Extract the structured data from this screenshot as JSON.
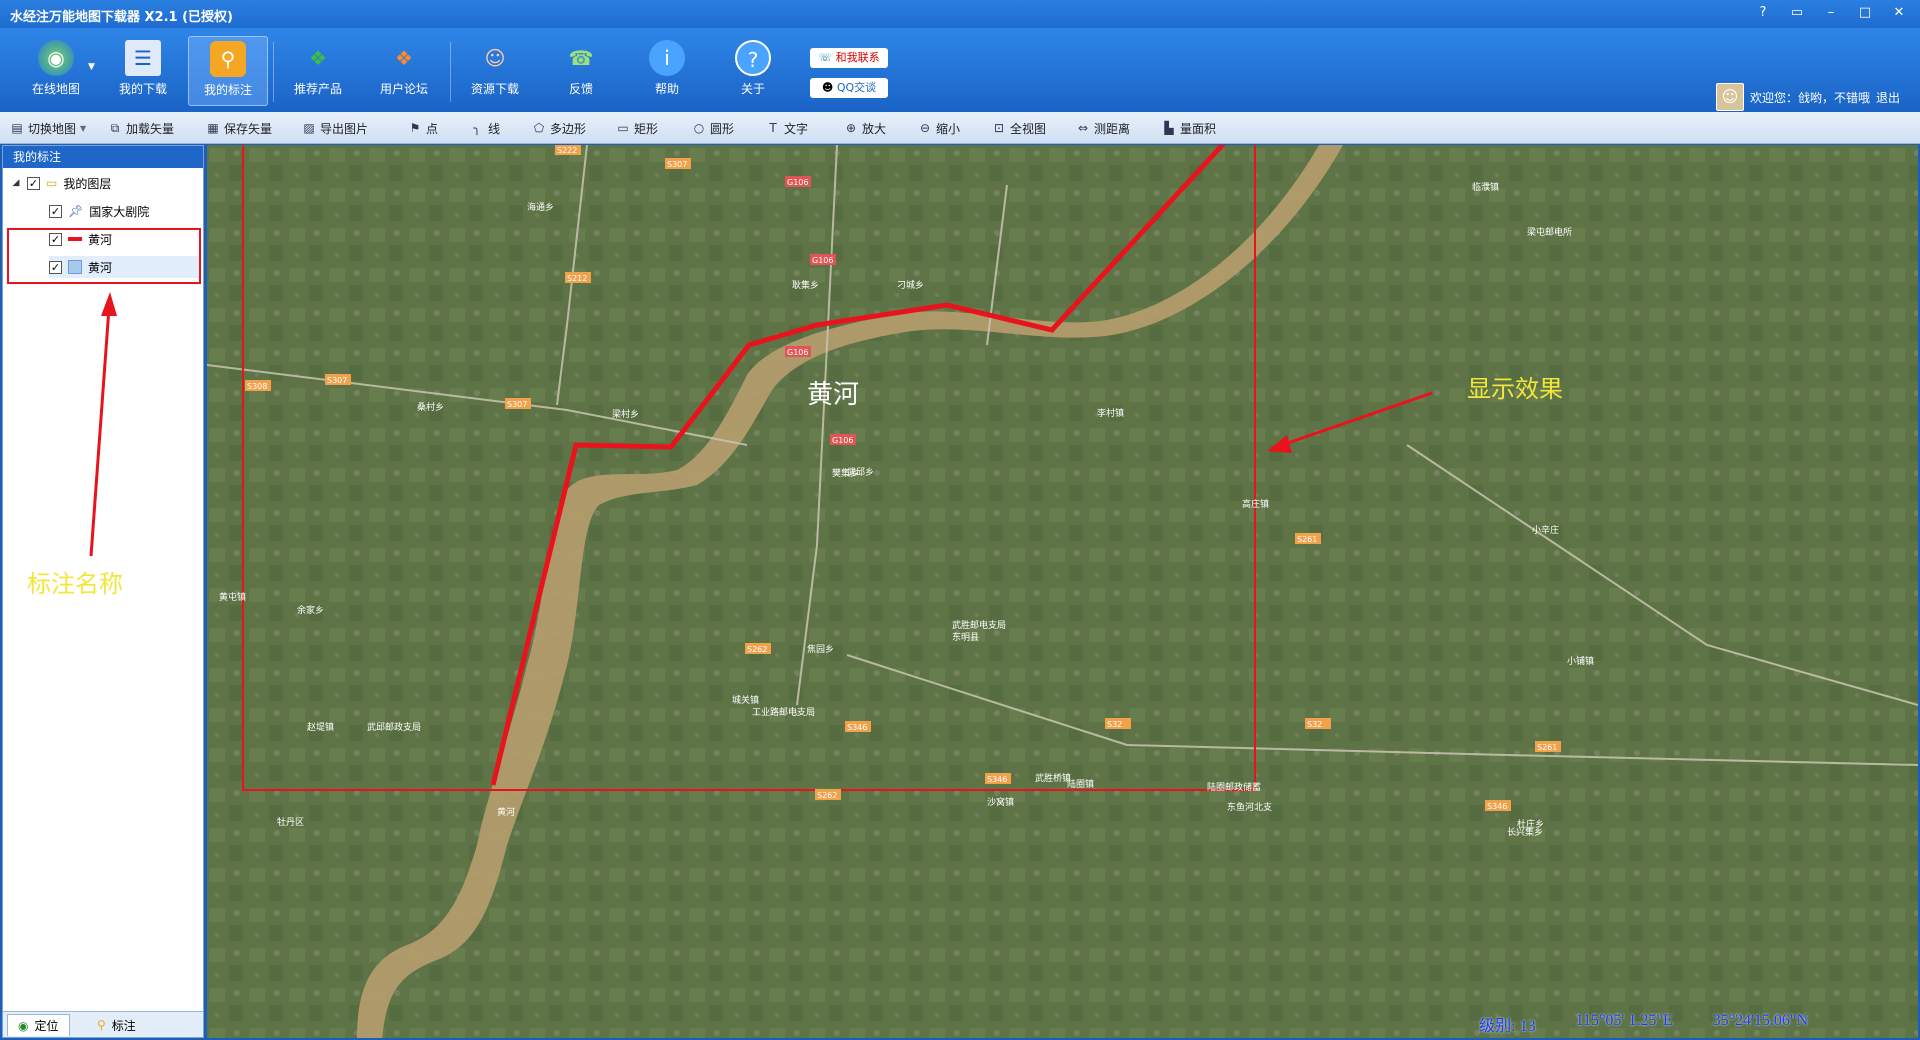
{
  "window": {
    "title": "水经注万能地图下载器 X2.1 (已授权)",
    "buttons": [
      "?",
      "▭",
      "–",
      "□",
      "✕"
    ]
  },
  "main_toolbar": {
    "buttons": [
      {
        "label": "在线地图",
        "icon": "globe-icon"
      },
      {
        "label": "我的下载",
        "icon": "download-list-icon"
      },
      {
        "label": "我的标注",
        "icon": "map-pin-icon"
      },
      {
        "label": "推荐产品",
        "icon": "cubes-icon"
      },
      {
        "label": "用户论坛",
        "icon": "forum-icon"
      },
      {
        "label": "资源下载",
        "icon": "people-icon"
      },
      {
        "label": "反馈",
        "icon": "feedback-icon"
      },
      {
        "label": "帮助",
        "icon": "info-icon"
      },
      {
        "label": "关于",
        "icon": "question-icon"
      }
    ],
    "contact_label": "和我联系",
    "qq_label": "QQ交谈",
    "user_text": "欢迎您：戗哟，不错哦",
    "logout_label": "退出"
  },
  "sub_toolbar": {
    "items": [
      {
        "label": "切换地图",
        "icon": "layers-icon"
      },
      {
        "label": "加载矢量",
        "icon": "load-vector-icon"
      },
      {
        "label": "保存矢量",
        "icon": "save-icon"
      },
      {
        "label": "导出图片",
        "icon": "export-image-icon"
      },
      {
        "label": "点",
        "icon": "point-icon"
      },
      {
        "label": "线",
        "icon": "line-icon"
      },
      {
        "label": "多边形",
        "icon": "polygon-icon"
      },
      {
        "label": "矩形",
        "icon": "rectangle-icon"
      },
      {
        "label": "圆形",
        "icon": "circle-icon"
      },
      {
        "label": "文字",
        "icon": "text-icon"
      },
      {
        "label": "放大",
        "icon": "zoom-in-icon"
      },
      {
        "label": "缩小",
        "icon": "zoom-out-icon"
      },
      {
        "label": "全视图",
        "icon": "full-view-icon"
      },
      {
        "label": "测距离",
        "icon": "measure-distance-icon"
      },
      {
        "label": "量面积",
        "icon": "measure-area-icon"
      }
    ]
  },
  "left_panel": {
    "header": "我的标注",
    "tree": [
      {
        "label": "我的图层",
        "type": "folder"
      },
      {
        "label": "国家大剧院",
        "type": "pin"
      },
      {
        "label": "黄河",
        "type": "line"
      },
      {
        "label": "黄河",
        "type": "polygon"
      }
    ],
    "annotation_text": "标注名称",
    "tabs": [
      {
        "label": "定位",
        "icon": "locate-icon"
      },
      {
        "label": "标注",
        "icon": "marker-icon"
      }
    ]
  },
  "map": {
    "river_label": "黄河",
    "display_annotation": "显示效果",
    "place_labels": [
      "S222",
      "S307",
      "G106",
      "S212",
      "S308",
      "S307",
      "S307",
      "G106",
      "G106",
      "G106",
      "S262",
      "S346",
      "S32",
      "S32",
      "S261",
      "S346",
      "S261",
      "S346",
      "S262",
      "海通乡",
      "耿集乡",
      "桑村乡",
      "梁村乡",
      "刁城乡",
      "樊集乡",
      "李村镇",
      "高庄镇",
      "小辛庄",
      "临濮镇",
      "梁屯邮电所",
      "小铺镇",
      "黄屯镇",
      "余家乡",
      "赵堤镇",
      "武邱邮政支局",
      "武邱乡",
      "焦园乡",
      "城关镇",
      "工业路邮电支局",
      "东明县",
      "武胜邮电支局",
      "武胜桥镇",
      "陆圈镇",
      "陆圈邮政储蓄",
      "沙窝镇",
      "东鱼河北支",
      "长兴集乡",
      "杜庄乡",
      "牡丹区",
      "黄河"
    ],
    "status_level": "级别: 13",
    "status_lon": "115°05' 1.25\"E",
    "status_lat": "35°24'15.06\"N"
  },
  "colors": {
    "annotation_red": "#e8131c",
    "annotation_yellow": "#f3e63a",
    "title_blue": "#1f6cd0"
  }
}
